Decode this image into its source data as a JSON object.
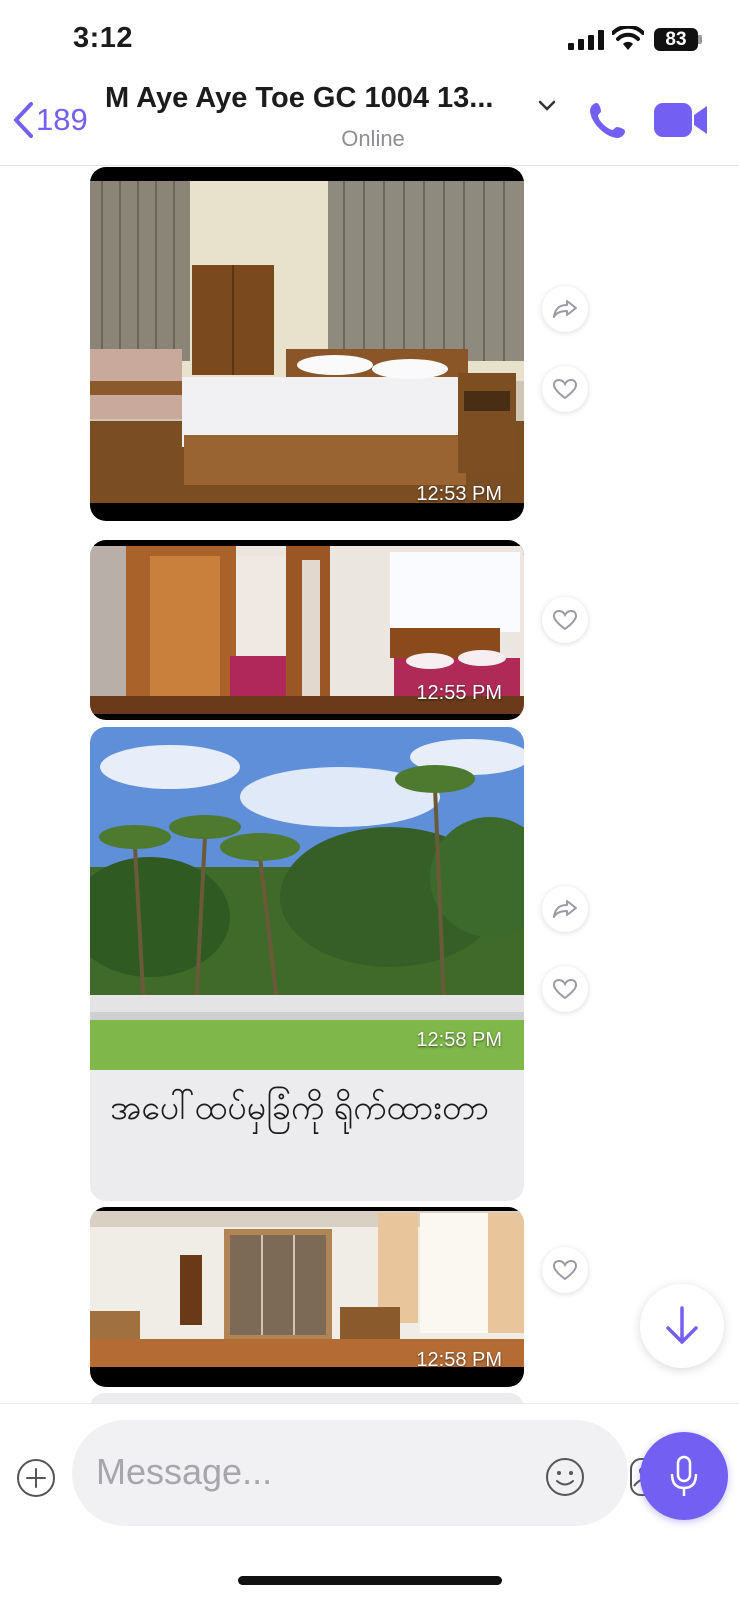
{
  "status_bar": {
    "time": "3:12",
    "battery": "83"
  },
  "header": {
    "back_count": "189",
    "title": "M Aye Aye Toe GC 1004 13...",
    "status": "Online"
  },
  "messages": [
    {
      "type": "image",
      "scene": "bedroom with wooden bed and curtains",
      "time": "12:53 PM",
      "has_forward": true
    },
    {
      "type": "image",
      "scene": "bedroom with mirrored wardrobe",
      "time": "12:55 PM",
      "has_forward": false
    },
    {
      "type": "image",
      "scene": "garden with coconut palms and lawn",
      "time": "12:58 PM",
      "has_forward": true,
      "caption": "အပေါ်ထပ်မှခြံကို ရိုက်ထားတာ"
    },
    {
      "type": "image",
      "scene": "hall with glass partition and curtains",
      "time": "12:58 PM",
      "has_forward": false
    }
  ],
  "input": {
    "placeholder": "Message..."
  },
  "colors": {
    "accent": "#7360f2",
    "caption_bg": "#ececef",
    "text_secondary": "#8e8e93"
  },
  "icons": [
    "back-chevron-icon",
    "chevron-down-icon",
    "phone-icon",
    "video-camera-icon",
    "forward-icon",
    "heart-icon",
    "arrow-down-icon",
    "plus-icon",
    "emoji-icon",
    "sticker-icon",
    "microphone-icon"
  ]
}
